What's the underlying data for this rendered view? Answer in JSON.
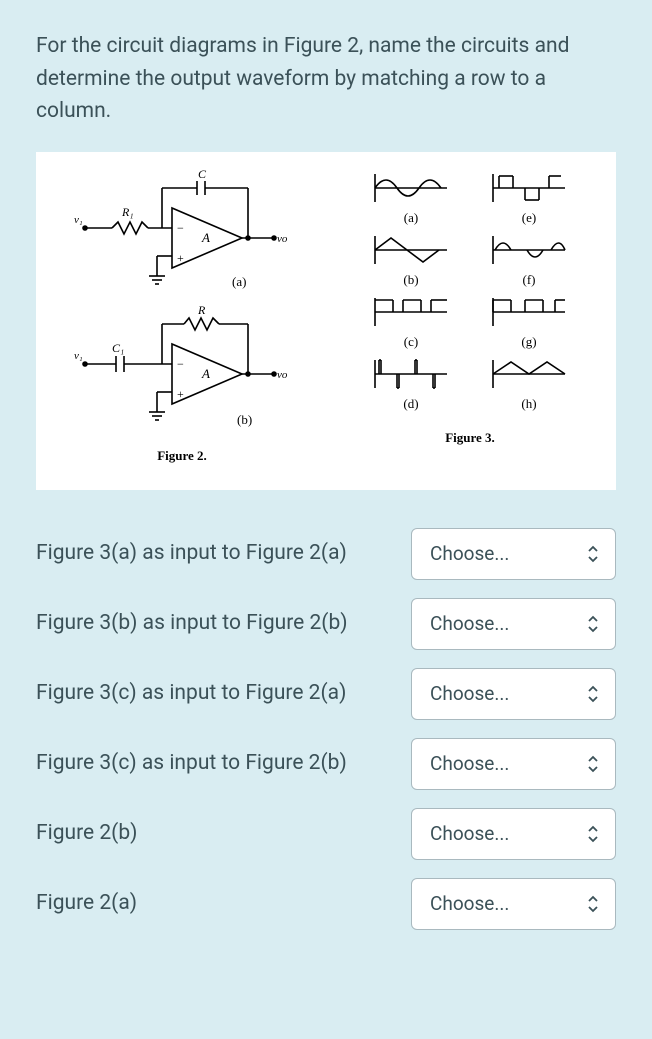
{
  "question": "For the circuit diagrams in Figure 2,  name the circuits and determine the output waveform by matching a row to a column.",
  "figure2_caption": "Figure 2.",
  "figure3_caption": "Figure 3.",
  "circuit_labels": {
    "a": "(a)",
    "b": "(b)"
  },
  "circuit_components": {
    "a_r1": "R₁",
    "a_c": "C",
    "a_a": "A",
    "a_vo": "vo",
    "a_v1": "v₁",
    "b_r": "R",
    "b_c1": "C₁",
    "b_a": "A",
    "b_vo": "vo",
    "b_v1": "v₁"
  },
  "waveforms": {
    "a": "(a)",
    "b": "(b)",
    "c": "(c)",
    "d": "(d)",
    "e": "(e)",
    "f": "(f)",
    "g": "(g)",
    "h": "(h)"
  },
  "rows": [
    {
      "label": "Figure 3(a) as input to Figure 2(a)",
      "placeholder": "Choose..."
    },
    {
      "label": "Figure 3(b) as input to Figure 2(b)",
      "placeholder": "Choose..."
    },
    {
      "label": "Figure 3(c) as input to Figure 2(a)",
      "placeholder": "Choose..."
    },
    {
      "label": "Figure 3(c) as input to Figure 2(b)",
      "placeholder": "Choose..."
    },
    {
      "label": "Figure 2(b)",
      "placeholder": "Choose..."
    },
    {
      "label": "Figure 2(a)",
      "placeholder": "Choose..."
    }
  ]
}
